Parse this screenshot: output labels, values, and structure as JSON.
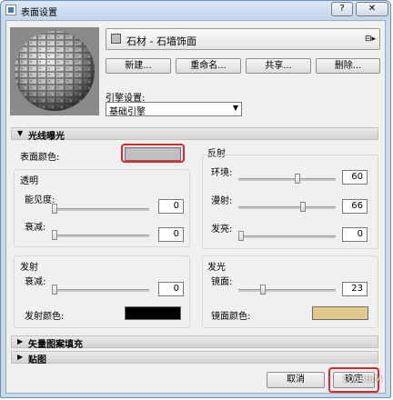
{
  "window": {
    "title": "表面设置",
    "help": "?",
    "close": "✕"
  },
  "material": {
    "name": "石材 - 石墙饰面",
    "icon": "material-options-icon"
  },
  "buttons": {
    "new": "新建...",
    "rename": "重命名...",
    "share": "共享...",
    "delete": "删除..."
  },
  "engine": {
    "label": "引擎设置:",
    "value": "基础引擎"
  },
  "sections": {
    "lighting": "光线曝光",
    "vector": "矢量图案填充",
    "texture": "贴图"
  },
  "lighting": {
    "surface_color_label": "表面颜色:",
    "surface_color": "#c0c0c0",
    "reflection": {
      "title": "反射",
      "ambient": {
        "label": "环境:",
        "value": "60",
        "level": 60
      },
      "diffuse": {
        "label": "漫射:",
        "value": "66",
        "level": 66
      },
      "specular": {
        "label": "发亮:",
        "value": "0",
        "level": 0
      }
    },
    "transparency": {
      "title": "透明",
      "opacity": {
        "label": "能见度:",
        "value": "0",
        "level": 0
      },
      "attenuation": {
        "label": "衰减:",
        "value": "0",
        "level": 0
      }
    },
    "emission": {
      "title": "发射",
      "attenuation": {
        "label": "衰减:",
        "value": "0",
        "level": 0
      },
      "color_label": "发射颜色:",
      "color": "#000000"
    },
    "gloss": {
      "title": "发光",
      "specular": {
        "label": "镜面:",
        "value": "23",
        "level": 23
      },
      "color_label": "镜面颜色:",
      "color": "#e2c98c"
    }
  },
  "footer": {
    "cancel": "取消",
    "ok": "确定"
  },
  "watermark": "1068BIM",
  "highlight_color": "#e0262b"
}
